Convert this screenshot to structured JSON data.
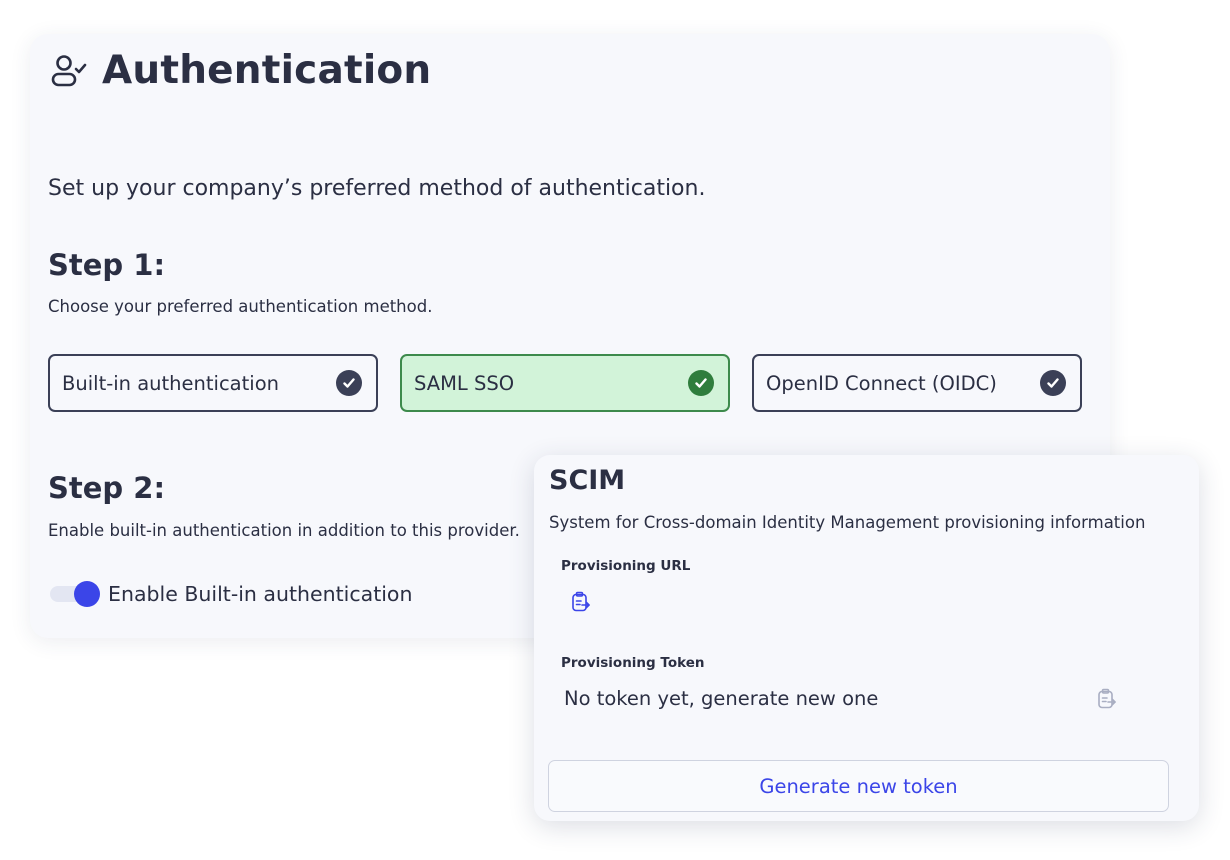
{
  "auth": {
    "title": "Authentication",
    "title_icon": "user-check-icon",
    "subtitle": "Set up your company’s preferred method of authentication.",
    "step1": {
      "heading": "Step 1:",
      "description": "Choose your preferred authentication method.",
      "methods": [
        {
          "label": "Built-in authentication",
          "selected": false,
          "icon": "check-circle-icon"
        },
        {
          "label": "SAML SSO",
          "selected": true,
          "icon": "check-circle-icon"
        },
        {
          "label": "OpenID Connect (OIDC)",
          "selected": false,
          "icon": "check-circle-icon"
        }
      ]
    },
    "step2": {
      "heading": "Step 2:",
      "description": "Enable built-in authentication in addition to this provider.",
      "toggle_label": "Enable Built-in authentication",
      "toggle_on": true
    }
  },
  "scim": {
    "title": "SCIM",
    "description": "System for Cross-domain Identity Management provisioning information",
    "provisioning_url_label": "Provisioning URL",
    "provisioning_url_value": "",
    "provisioning_token_label": "Provisioning Token",
    "provisioning_token_value": "No token yet, generate new one",
    "copy_icon": "clipboard-copy-icon",
    "generate_button_label": "Generate new token"
  },
  "colors": {
    "text": "#2b2f43",
    "accent": "#3b45e8",
    "selected_bg": "#d2f3d9",
    "selected_border": "#3d8a4c",
    "selected_check": "#2f7d3d",
    "card_bg": "#f7f8fc"
  }
}
